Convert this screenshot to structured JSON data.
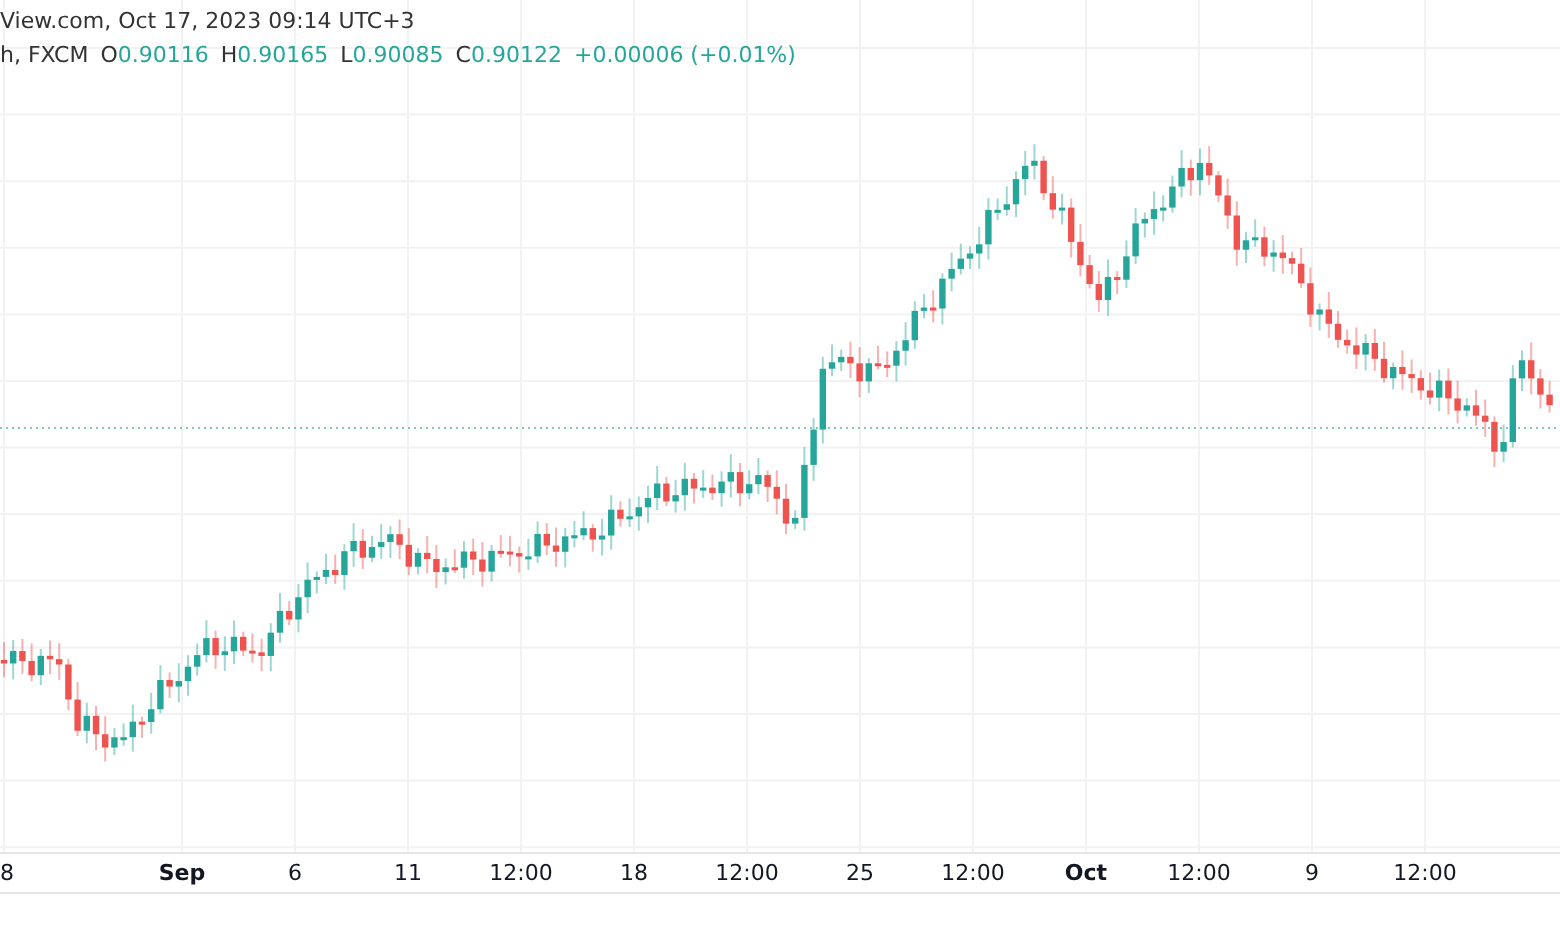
{
  "header": {
    "source": "View.com, Oct 17, 2023 09:14 UTC+3",
    "symbol": "h, FXCM",
    "ohlc": [
      {
        "label": "O",
        "value": "0.90116"
      },
      {
        "label": "H",
        "value": "0.90165"
      },
      {
        "label": "L",
        "value": "0.90085"
      },
      {
        "label": "C",
        "value": "0.90122"
      }
    ],
    "change": "+0.00006 (+0.01%)"
  },
  "time_axis": {
    "labels": [
      {
        "text": "8",
        "kind": "day"
      },
      {
        "text": "Sep",
        "kind": "month"
      },
      {
        "text": "6",
        "kind": "day"
      },
      {
        "text": "11",
        "kind": "day"
      },
      {
        "text": "12:00",
        "kind": "time"
      },
      {
        "text": "18",
        "kind": "day"
      },
      {
        "text": "12:00",
        "kind": "time"
      },
      {
        "text": "25",
        "kind": "day"
      },
      {
        "text": "12:00",
        "kind": "time"
      },
      {
        "text": "Oct",
        "kind": "month"
      },
      {
        "text": "12:00",
        "kind": "time"
      },
      {
        "text": "9",
        "kind": "day"
      },
      {
        "text": "12:00",
        "kind": "time"
      }
    ]
  }
}
